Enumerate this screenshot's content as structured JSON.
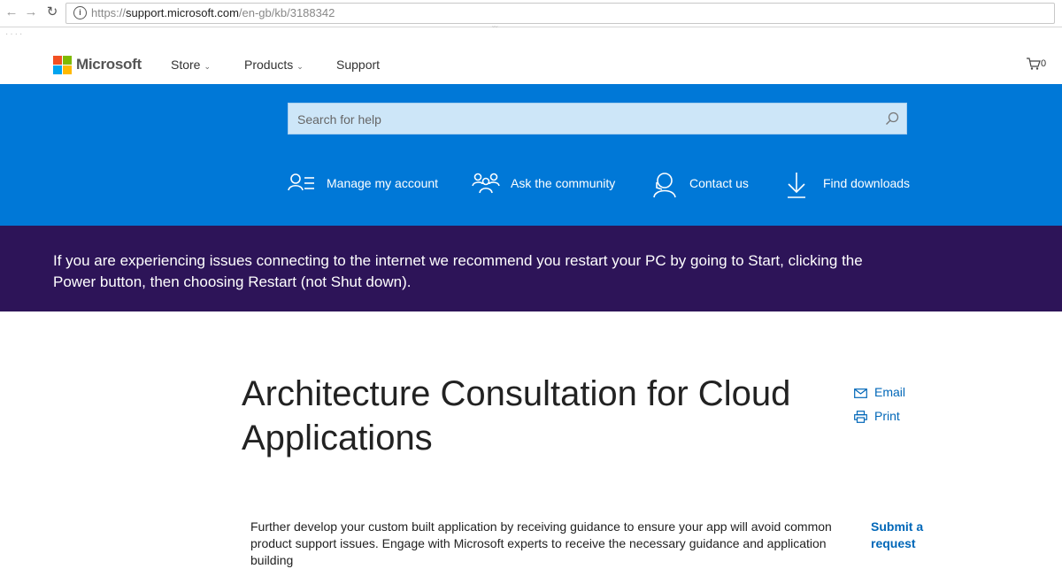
{
  "browser": {
    "url_prefix": "https://",
    "url_host": "support.microsoft.com",
    "url_path": "/en-gb/kb/3188342"
  },
  "header": {
    "brand": "Microsoft",
    "nav": [
      {
        "label": "Store",
        "has_dropdown": true
      },
      {
        "label": "Products",
        "has_dropdown": true
      },
      {
        "label": "Support",
        "has_dropdown": false
      }
    ],
    "cart_count": "0"
  },
  "hero": {
    "search_placeholder": "Search for help",
    "links": [
      {
        "label": "Manage my account",
        "icon": "account-list-icon"
      },
      {
        "label": "Ask the community",
        "icon": "community-icon"
      },
      {
        "label": "Contact us",
        "icon": "headset-icon"
      },
      {
        "label": "Find downloads",
        "icon": "download-icon"
      }
    ]
  },
  "banner": {
    "message": "If you are experiencing issues connecting to the internet we recommend you restart your PC by going to Start, clicking the Power button, then choosing Restart (not Shut down)."
  },
  "article": {
    "title": "Architecture Consultation for Cloud Applications",
    "actions": [
      {
        "label": "Email",
        "icon": "mail-icon"
      },
      {
        "label": "Print",
        "icon": "printer-icon"
      }
    ],
    "description": "Further develop your custom built application by receiving guidance to ensure your app will avoid common product support issues. Engage with Microsoft experts to receive the necessary guidance and application building",
    "submit_label": "Submit a request"
  },
  "colors": {
    "hero_blue": "#0078d7",
    "banner_purple": "#2d1458",
    "link_blue": "#0067b8"
  }
}
